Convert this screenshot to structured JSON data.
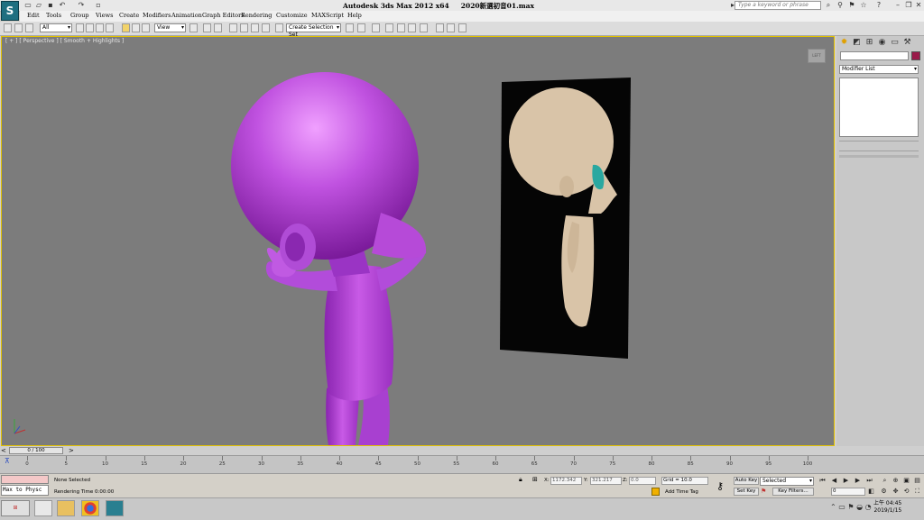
{
  "window": {
    "title": "Autodesk 3ds Max  2012 x64",
    "file": "2020新選初音01.max",
    "search_placeholder": "Type a keyword or phrase",
    "logo_letter": "S"
  },
  "menu": [
    "Edit",
    "Tools",
    "Group",
    "Views",
    "Create",
    "Modifiers",
    "Animation",
    "Graph Editors",
    "Rendering",
    "Customize",
    "MAXScript",
    "Help"
  ],
  "toolbar": {
    "selection_filter": "All",
    "ref_coord": "View",
    "named_selection": "Create Selection Set"
  },
  "viewport": {
    "label": "[ + ] [ Perspective ] [ Smooth + Highlights ]",
    "viewcube_label": "LEFT",
    "model_color": "#c052e0",
    "ref_skin_color": "#d9c4a8",
    "ref_eye_color": "#2aa8a0"
  },
  "command_panel": {
    "modifier_list": "Modifier List"
  },
  "timeline": {
    "frame_display": "0 / 100",
    "ticks": [
      0,
      5,
      10,
      15,
      20,
      25,
      30,
      35,
      40,
      45,
      50,
      55,
      60,
      65,
      70,
      75,
      80,
      85,
      90,
      95,
      100
    ]
  },
  "status": {
    "maxscript": "Max to Physc",
    "selection": "None Selected",
    "render_time": "Rendering Time  0:00:00",
    "x_label": "X:",
    "x_value": "1172.342",
    "y_label": "Y:",
    "y_value": "321.217",
    "z_label": "Z:",
    "z_value": "0.0",
    "grid": "Grid = 10.0",
    "add_time_tag": "Add Time Tag",
    "auto_key": "Auto Key",
    "set_key": "Set Key",
    "key_mode": "Selected",
    "key_filters": "Key Filters...",
    "current_frame": "0"
  },
  "taskbar": {
    "clock_time": "上午 04:45",
    "clock_date": "2019/1/15"
  }
}
